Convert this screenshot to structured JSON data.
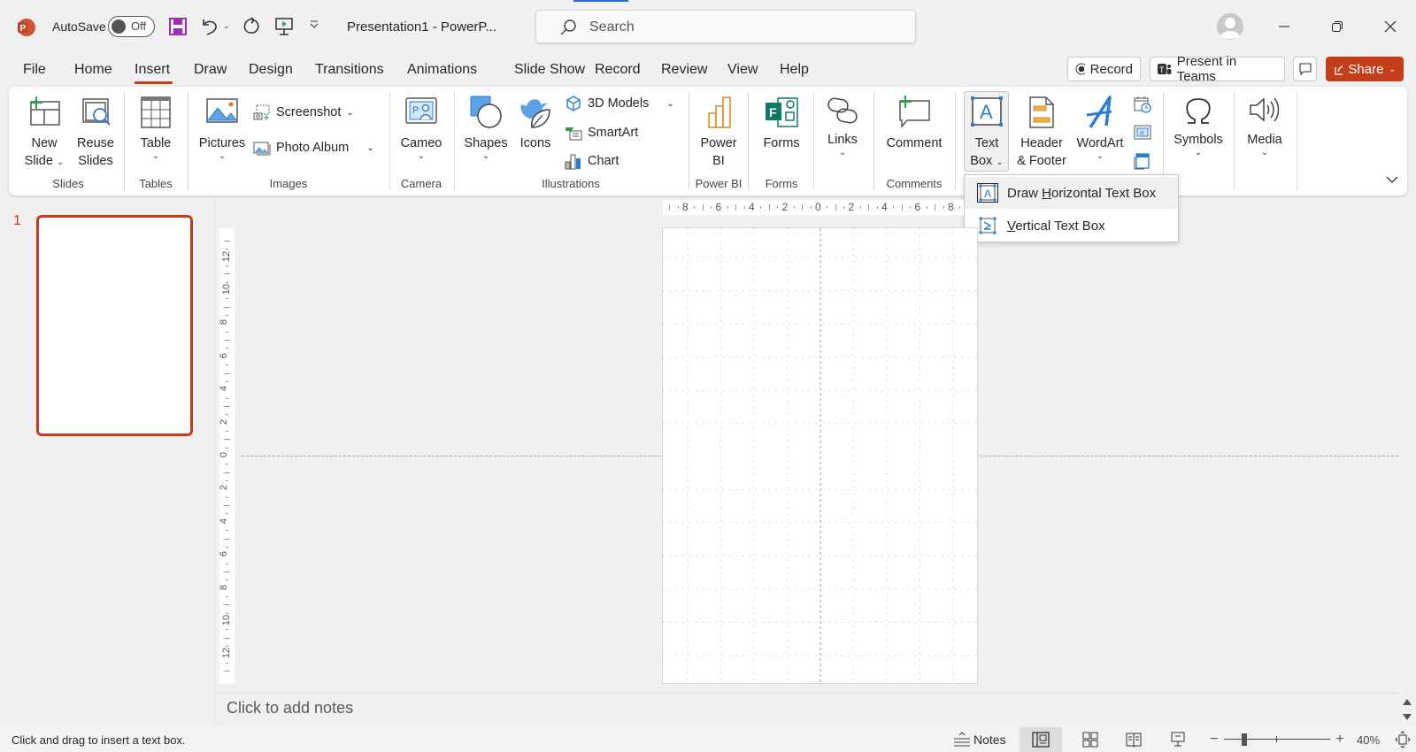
{
  "titlebar": {
    "autosave_label": "AutoSave",
    "autosave_state": "Off",
    "doc_title": "Presentation1  -  PowerP...",
    "search_placeholder": "Search",
    "icons": [
      "powerpoint-logo-icon",
      "save-icon",
      "undo-icon",
      "undo-dropdown-icon",
      "redo-icon",
      "start-from-beginning-icon",
      "customize-qat-icon",
      "user-avatar-icon",
      "minimize-icon",
      "restore-icon",
      "close-icon"
    ]
  },
  "menu": {
    "tabs": [
      "File",
      "Home",
      "Insert",
      "Draw",
      "Design",
      "Transitions",
      "Animations",
      "Slide Show",
      "Record",
      "Review",
      "View",
      "Help"
    ],
    "active_tab": "Insert",
    "record_button": "Record",
    "present_teams_button": "Present in Teams",
    "share_button": "Share"
  },
  "ribbon": {
    "groups": [
      {
        "name": "Slides",
        "items": [
          {
            "label1": "New",
            "label2": "Slide"
          },
          {
            "label1": "Reuse",
            "label2": "Slides"
          }
        ]
      },
      {
        "name": "Tables",
        "items": [
          {
            "label1": "Table"
          }
        ]
      },
      {
        "name": "Images",
        "items": [
          {
            "label1": "Pictures"
          },
          {
            "label1": "Screenshot"
          },
          {
            "label1": "Photo Album"
          }
        ]
      },
      {
        "name": "Camera",
        "items": [
          {
            "label1": "Cameo"
          }
        ]
      },
      {
        "name": "Illustrations",
        "items": [
          {
            "label1": "Shapes"
          },
          {
            "label1": "Icons"
          },
          {
            "label1": "3D Models"
          },
          {
            "label1": "SmartArt"
          },
          {
            "label1": "Chart"
          }
        ]
      },
      {
        "name": "Power BI",
        "items": [
          {
            "label1": "Power",
            "label2": "BI"
          }
        ]
      },
      {
        "name": "Forms",
        "items": [
          {
            "label1": "Forms"
          }
        ]
      },
      {
        "name": "",
        "items": [
          {
            "label1": "Links"
          }
        ]
      },
      {
        "name": "Comments",
        "items": [
          {
            "label1": "Comment"
          }
        ]
      },
      {
        "name": "",
        "items": [
          {
            "label1": "Text",
            "label2": "Box"
          },
          {
            "label1": "Header",
            "label2": "& Footer"
          },
          {
            "label1": "WordArt"
          }
        ]
      },
      {
        "name": "",
        "items": [
          {
            "label1": "Symbols"
          }
        ]
      },
      {
        "name": "",
        "items": [
          {
            "label1": "Media"
          }
        ]
      }
    ]
  },
  "textbox_menu": {
    "items": [
      {
        "pre": "Draw ",
        "accel": "H",
        "post": "orizontal Text Box"
      },
      {
        "pre": "",
        "accel": "V",
        "post": "ertical Text Box"
      }
    ]
  },
  "slides_pane": {
    "slide_number": "1"
  },
  "rulers": {
    "horizontal": [
      "8",
      "6",
      "4",
      "2",
      "0",
      "2",
      "4",
      "6",
      "8"
    ],
    "vertical": [
      "12",
      "10",
      "8",
      "6",
      "4",
      "2",
      "0",
      "2",
      "4",
      "6",
      "8",
      "10",
      "12"
    ]
  },
  "notes": {
    "placeholder": "Click to add notes"
  },
  "statusbar": {
    "message": "Click and drag to insert a text box.",
    "notes_label": "Notes",
    "zoom_percent": "40%",
    "zoom_value": 40
  },
  "colors": {
    "accent": "#c43e1c",
    "blue": "#2b7cd3"
  }
}
